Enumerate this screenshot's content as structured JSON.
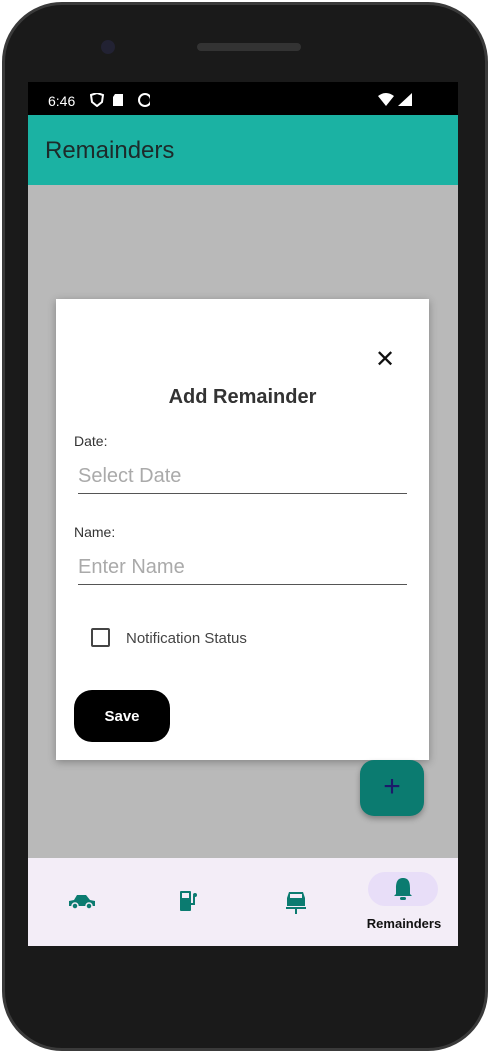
{
  "status_bar": {
    "time": "6:46"
  },
  "app_bar": {
    "title": "Remainders"
  },
  "dialog": {
    "title": "Add Remainder",
    "date_label": "Date:",
    "date_placeholder": "Select Date",
    "name_label": "Name:",
    "name_placeholder": "Enter Name",
    "notification_label": "Notification Status",
    "notification_checked": false,
    "save_label": "Save"
  },
  "fab": {
    "label": "+"
  },
  "bottom_nav": {
    "items": [
      {
        "icon": "car-icon",
        "label": ""
      },
      {
        "icon": "ev-station-icon",
        "label": ""
      },
      {
        "icon": "car-lift-icon",
        "label": ""
      },
      {
        "icon": "bell-icon",
        "label": "Remainders",
        "selected": true
      }
    ]
  },
  "colors": {
    "app_bar": "#1bb2a3",
    "accent": "#0b7b70",
    "nav_bg": "#f3edf7",
    "pill": "#e8def8"
  }
}
